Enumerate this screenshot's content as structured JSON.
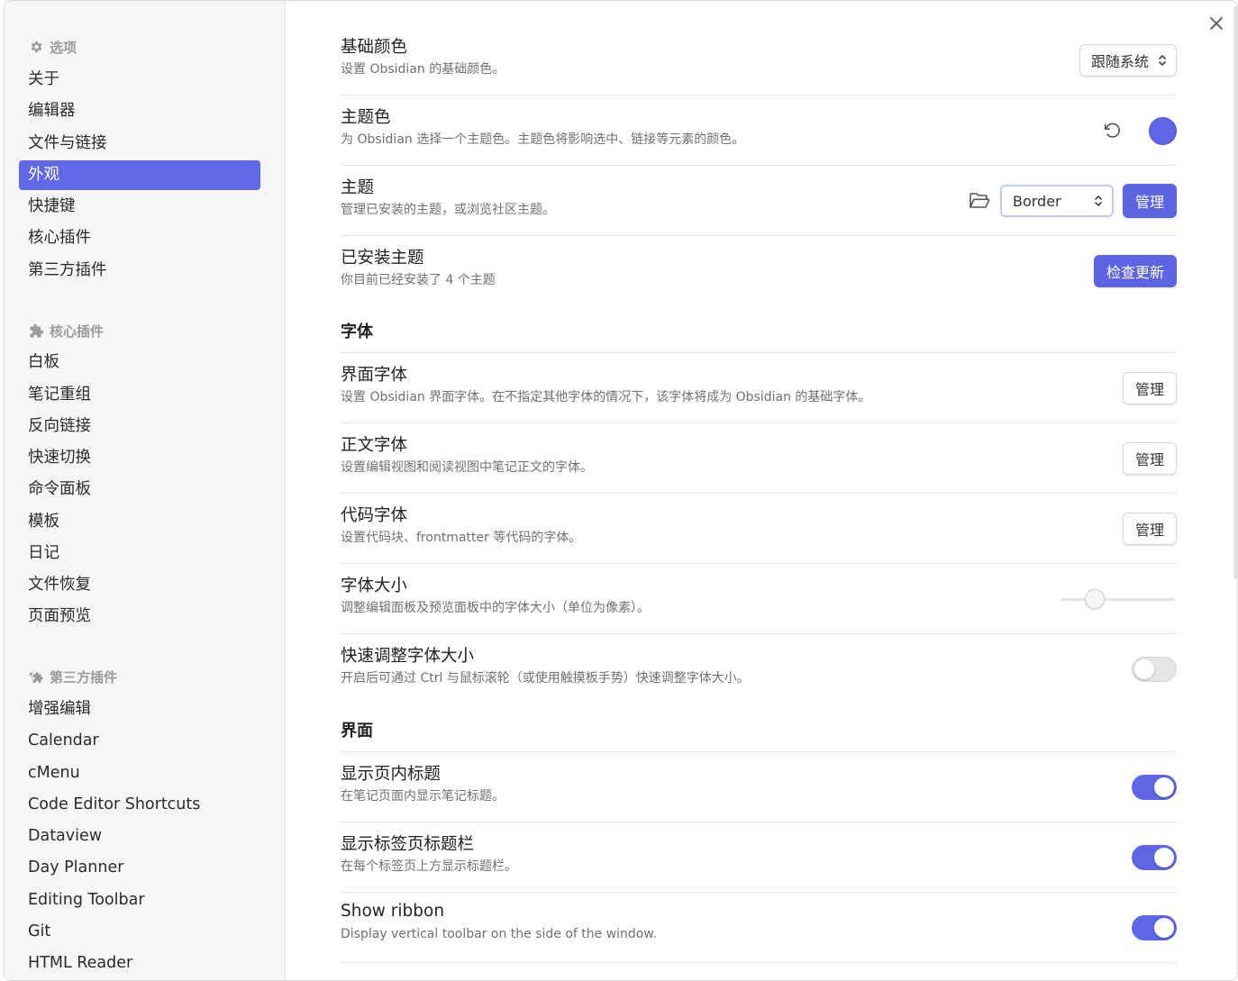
{
  "sidebar": {
    "sections": [
      {
        "header": "选项",
        "icon": "gear-icon",
        "items": [
          "关于",
          "编辑器",
          "文件与链接",
          "外观",
          "快捷键",
          "核心插件",
          "第三方插件"
        ],
        "active_index": 3
      },
      {
        "header": "核心插件",
        "icon": "puzzle-icon",
        "items": [
          "白板",
          "笔记重组",
          "反向链接",
          "快速切换",
          "命令面板",
          "模板",
          "日记",
          "文件恢复",
          "页面预览"
        ]
      },
      {
        "header": "第三方插件",
        "icon": "puzzle-multi-icon",
        "items": [
          "增强编辑",
          "Calendar",
          "cMenu",
          "Code Editor Shortcuts",
          "Dataview",
          "Day Planner",
          "Editing Toolbar",
          "Git",
          "HTML Reader"
        ]
      }
    ]
  },
  "settings": {
    "base_color": {
      "name": "基础颜色",
      "desc": "设置 Obsidian 的基础颜色。",
      "value": "跟随系统"
    },
    "accent_color": {
      "name": "主题色",
      "desc": "为 Obsidian 选择一个主题色。主题色将影响选中、链接等元素的颜色。",
      "color": "#5e66e6"
    },
    "theme": {
      "name": "主题",
      "desc": "管理已安装的主题，或浏览社区主题。",
      "value": "Border",
      "manage": "管理"
    },
    "installed_themes": {
      "name": "已安装主题",
      "desc": "你目前已经安装了 4 个主题",
      "button": "检查更新"
    },
    "font_section": "字体",
    "interface_font": {
      "name": "界面字体",
      "desc": "设置 Obsidian 界面字体。在不指定其他字体的情况下，该字体将成为 Obsidian 的基础字体。",
      "button": "管理"
    },
    "text_font": {
      "name": "正文字体",
      "desc": "设置编辑视图和阅读视图中笔记正文的字体。",
      "button": "管理"
    },
    "code_font": {
      "name": "代码字体",
      "desc": "设置代码块、frontmatter 等代码的字体。",
      "button": "管理"
    },
    "font_size": {
      "name": "字体大小",
      "desc": "调整编辑面板及预览面板中的字体大小（单位为像素）。",
      "level": 0.25
    },
    "quick_font_size": {
      "name": "快速调整字体大小",
      "desc": "开启后可通过 Ctrl 与鼠标滚轮（或使用触摸板手势）快速调整字体大小。",
      "on": false
    },
    "interface_section": "界面",
    "show_inline_title": {
      "name": "显示页内标题",
      "desc": "在笔记页面内显示笔记标题。",
      "on": true
    },
    "show_tab_title_bar": {
      "name": "显示标签页标题栏",
      "desc": "在每个标签页上方显示标题栏。",
      "on": true
    },
    "show_ribbon": {
      "name": "Show ribbon",
      "desc": "Display vertical toolbar on the side of the window.",
      "on": true
    }
  }
}
